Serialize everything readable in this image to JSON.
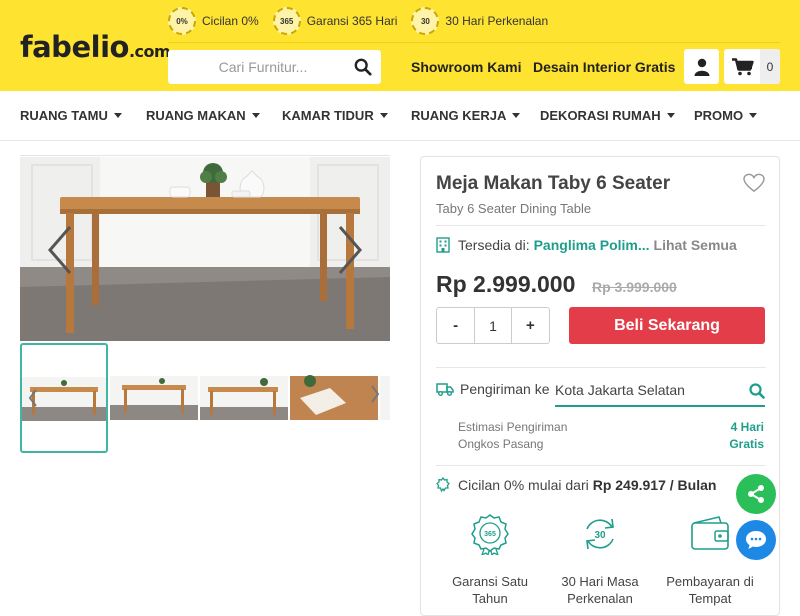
{
  "brand": {
    "logo_main": "fabel",
    "logo_io": "io",
    "logo_suffix": ".com"
  },
  "perks": [
    {
      "badge": "0%",
      "label": "Cicilan 0%"
    },
    {
      "badge": "365",
      "label": "Garansi 365 Hari"
    },
    {
      "badge": "30",
      "label": "30 Hari Perkenalan"
    }
  ],
  "search": {
    "placeholder": "Cari Furnitur...",
    "value": ""
  },
  "header_links": {
    "showroom": "Showroom Kami",
    "design": "Desain Interior Gratis"
  },
  "cart": {
    "count": "0"
  },
  "categories": [
    "RUANG TAMU",
    "RUANG MAKAN",
    "KAMAR TIDUR",
    "RUANG KERJA",
    "DEKORASI RUMAH",
    "PROMO"
  ],
  "product": {
    "title": "Meja Makan Taby 6 Seater",
    "subtitle": "Taby 6 Seater Dining Table",
    "availability_label": "Tersedia di:",
    "availability_location": "Panglima Polim...",
    "availability_link": "Lihat Semua",
    "price": "Rp 2.999.000",
    "old_price": "Rp 3.999.000",
    "quantity": "1",
    "qty_minus": "-",
    "qty_plus": "+",
    "buy_label": "Beli Sekarang"
  },
  "shipping": {
    "label": "Pengiriman ke",
    "destination": "Kota Jakarta Selatan",
    "estimate_label": "Estimasi Pengiriman",
    "estimate_value": "4 Hari",
    "install_label": "Ongkos Pasang",
    "install_value": "Gratis"
  },
  "installment": {
    "text": "Cicilan 0% mulai dari",
    "amount": "Rp 249.917 / Bulan"
  },
  "features": [
    {
      "icon": "warranty-badge-icon",
      "badge": "365",
      "label": "Garansi Satu Tahun"
    },
    {
      "icon": "refresh-icon",
      "badge": "30",
      "label": "30 Hari Masa Perkenalan"
    },
    {
      "icon": "wallet-icon",
      "badge": "",
      "label": "Pembayaran di Tempat"
    }
  ],
  "colors": {
    "header_bg": "#ffe331",
    "accent": "#1f9e8c",
    "buy_button": "#e33d4a",
    "share_fab": "#2bbf5a",
    "chat_fab": "#1e88e5"
  }
}
